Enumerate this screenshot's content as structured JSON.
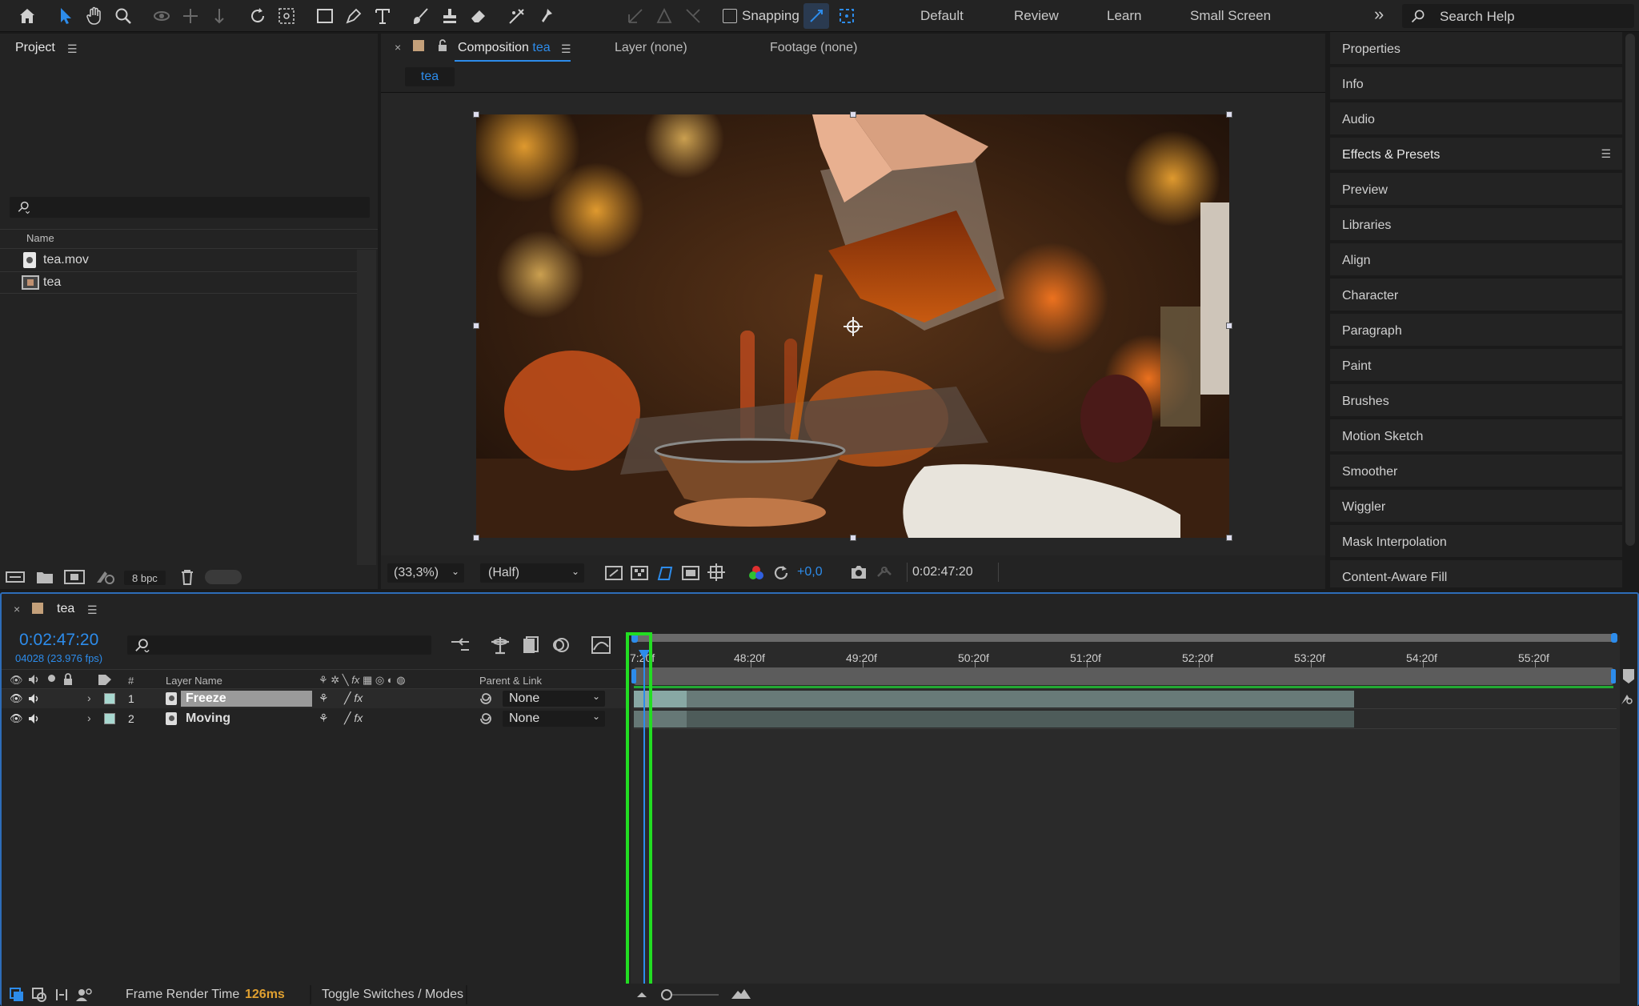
{
  "toolbar": {
    "snapping_label": "Snapping",
    "workspaces": [
      "Default",
      "Review",
      "Learn",
      "Small Screen"
    ],
    "overflow": "»",
    "search_placeholder": "Search Help"
  },
  "project": {
    "title": "Project",
    "column_name": "Name",
    "items": [
      {
        "name": "tea.mov",
        "icon": "footage-icon"
      },
      {
        "name": "tea",
        "icon": "composition-icon"
      }
    ],
    "bpc": "8 bpc"
  },
  "viewer": {
    "tab_composition": "Composition",
    "tab_composition_name": "tea",
    "tab_layer": "Layer (none)",
    "tab_footage": "Footage (none)",
    "breadcrumb": "tea",
    "zoom": "(33,3%)",
    "resolution": "(Half)",
    "exposure": "+0,0",
    "timecode": "0:02:47:20"
  },
  "right_panel": {
    "items": [
      "Properties",
      "Info",
      "Audio",
      "Effects & Presets",
      "Preview",
      "Libraries",
      "Align",
      "Character",
      "Paragraph",
      "Paint",
      "Brushes",
      "Motion Sketch",
      "Smoother",
      "Wiggler",
      "Mask Interpolation",
      "Content-Aware Fill"
    ]
  },
  "timeline": {
    "comp_name": "tea",
    "current_time": "0:02:47:20",
    "frame_info": "04028 (23.976 fps)",
    "col_hash": "#",
    "col_layer_name": "Layer Name",
    "col_parent": "Parent & Link",
    "ruler": [
      "48:20f",
      "49:20f",
      "50:20f",
      "51:20f",
      "52:20f",
      "53:20f",
      "54:20f",
      "55:20f"
    ],
    "ruler_start": "7:20f",
    "layers": [
      {
        "num": "1",
        "name": "Freeze",
        "parent": "None",
        "label_color": "#a8d8d0"
      },
      {
        "num": "2",
        "name": "Moving",
        "parent": "None",
        "label_color": "#a8d8d0"
      }
    ],
    "footer_render_label": "Frame Render Time",
    "footer_render_value": "126ms",
    "footer_toggle": "Toggle Switches / Modes"
  },
  "colors": {
    "accent": "#2d8ceb",
    "highlight": "#22dd22"
  }
}
